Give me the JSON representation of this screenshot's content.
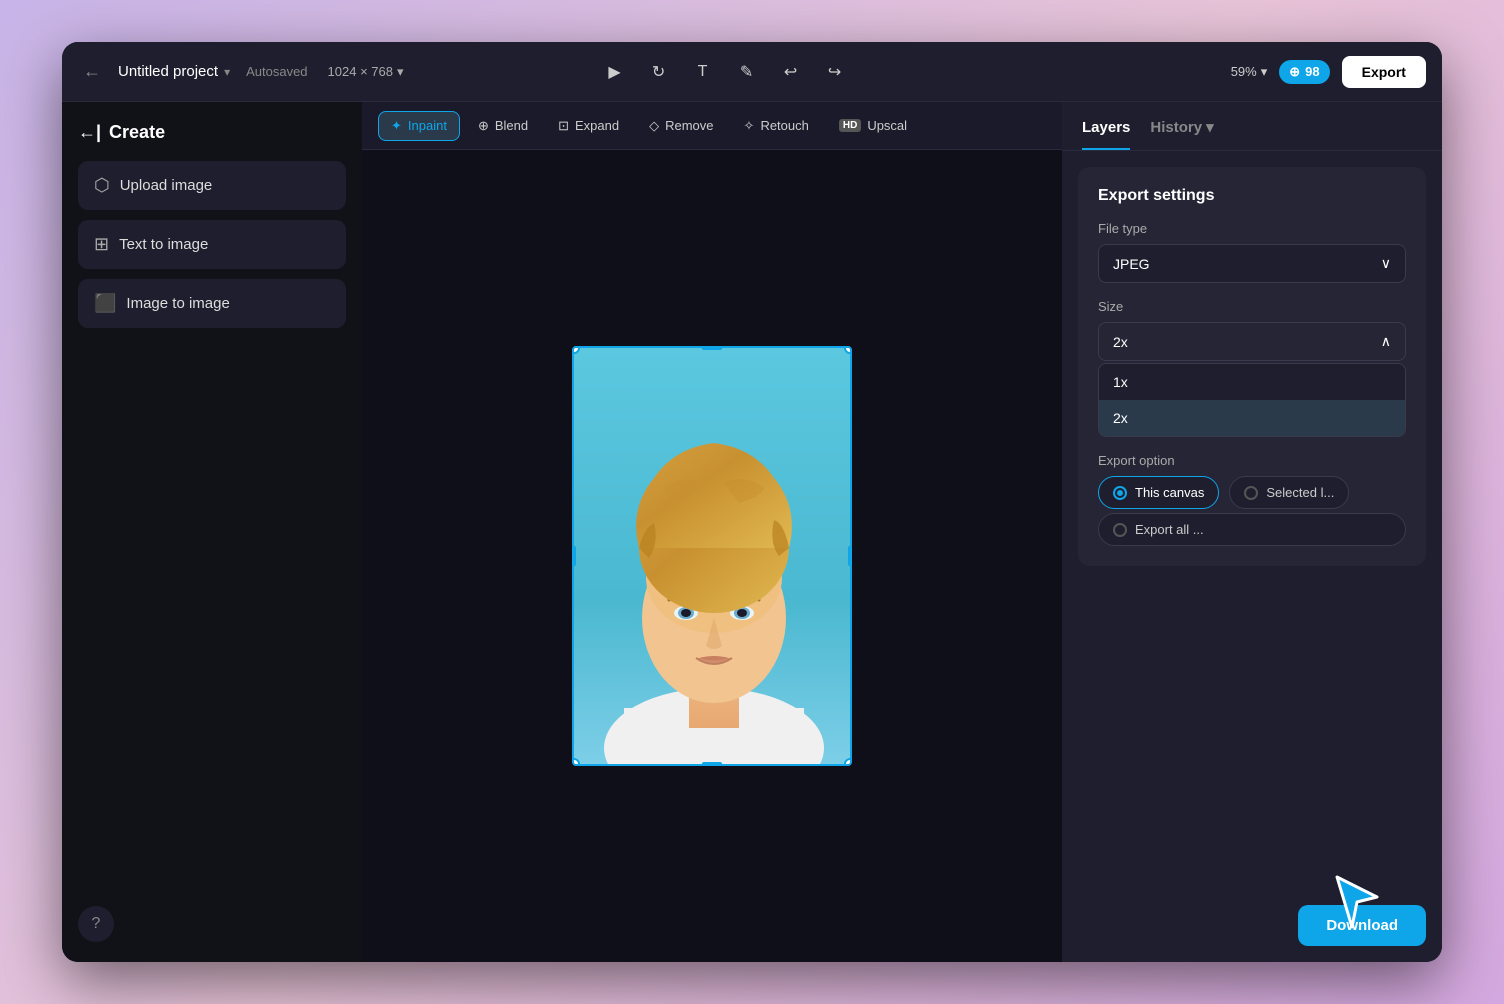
{
  "header": {
    "back_icon": "←",
    "title": "Untitled project",
    "title_chevron": "▾",
    "autosaved": "Autosaved",
    "dimensions": "1024 × 768",
    "dimensions_chevron": "▾",
    "tools": [
      {
        "name": "select",
        "icon": "▶"
      },
      {
        "name": "rotate",
        "icon": "↻"
      },
      {
        "name": "text",
        "icon": "T"
      },
      {
        "name": "pen",
        "icon": "✎"
      },
      {
        "name": "undo",
        "icon": "↩"
      },
      {
        "name": "redo",
        "icon": "↪"
      }
    ],
    "zoom": "59%",
    "zoom_chevron": "▾",
    "credits_icon": "⊕",
    "credits": "98",
    "export_label": "Export"
  },
  "sidebar": {
    "title": "Create",
    "back_icon": "←|",
    "items": [
      {
        "icon": "⬡",
        "label": "Upload image"
      },
      {
        "icon": "⊞",
        "label": "Text to image"
      },
      {
        "icon": "⬛",
        "label": "Image to image"
      }
    ],
    "help_icon": "?"
  },
  "toolbar": {
    "buttons": [
      {
        "label": "Inpaint",
        "icon": "✦",
        "active": true
      },
      {
        "label": "Blend",
        "icon": "⊕",
        "active": false
      },
      {
        "label": "Expand",
        "icon": "⊡",
        "active": false
      },
      {
        "label": "Remove",
        "icon": "◇",
        "active": false
      },
      {
        "label": "Retouch",
        "icon": "✧",
        "active": false
      },
      {
        "label": "HD Upscal",
        "prefix": "HD",
        "active": false
      }
    ]
  },
  "right_panel": {
    "layers_tab": "Layers",
    "history_tab": "History",
    "history_chevron": "▾",
    "export_settings": {
      "title": "Export settings",
      "file_type_label": "File type",
      "file_type_value": "JPEG",
      "size_label": "Size",
      "size_options": [
        {
          "value": "1x",
          "selected": false
        },
        {
          "value": "2x",
          "selected": true
        }
      ],
      "current_size": "2x",
      "export_option_label": "Export option",
      "export_options": [
        {
          "label": "This canvas",
          "active": true
        },
        {
          "label": "Selected l...",
          "active": false
        }
      ],
      "export_all_label": "Export all ..."
    },
    "download_label": "Download"
  }
}
